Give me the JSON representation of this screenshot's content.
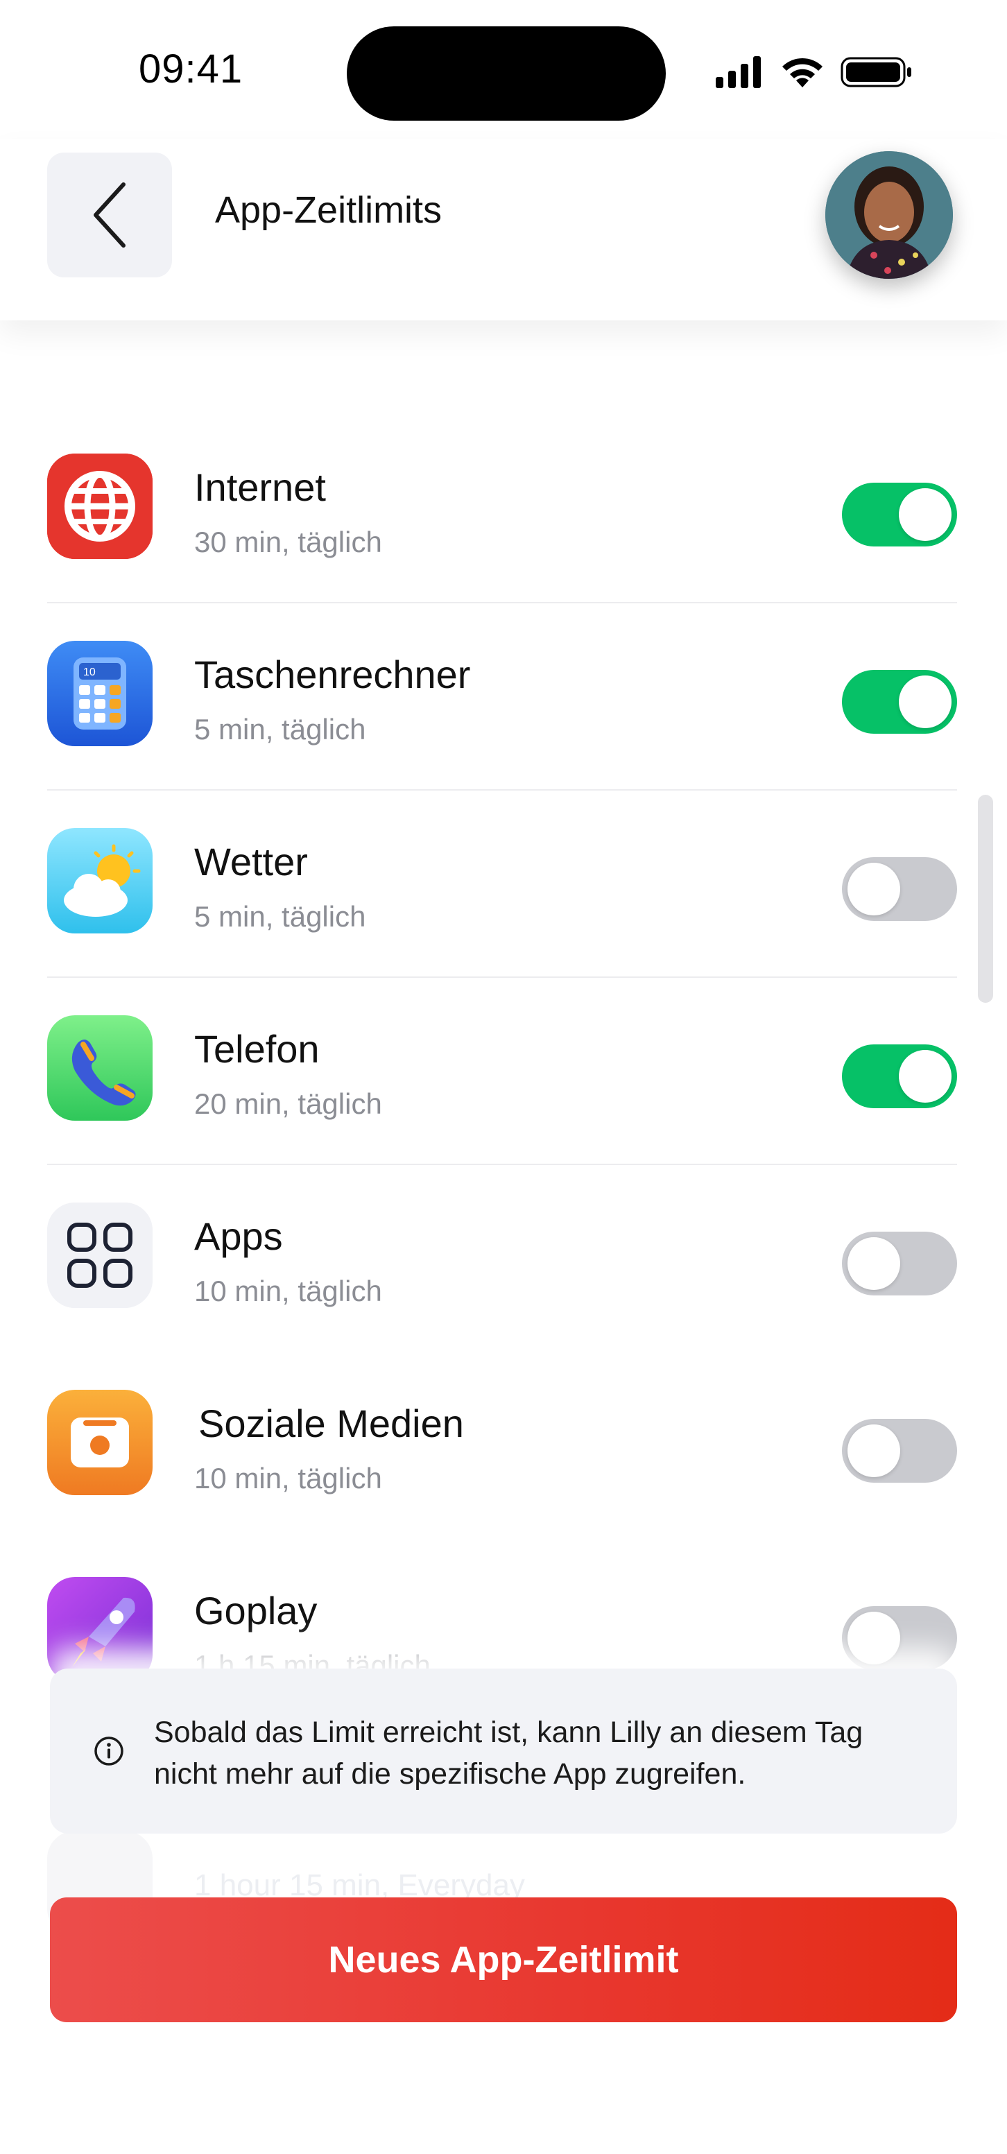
{
  "status_bar": {
    "time": "09:41"
  },
  "header": {
    "title": "App-Zeitlimits"
  },
  "apps": [
    {
      "name": "Internet",
      "limit": "30 min, täglich",
      "enabled": true,
      "icon": "globe-icon",
      "color": "#e8382f"
    },
    {
      "name": "Taschenrechner",
      "limit": "5 min, täglich",
      "enabled": true,
      "icon": "calculator-icon",
      "color": "#2f6fe8"
    },
    {
      "name": "Wetter",
      "limit": "5 min, täglich",
      "enabled": false,
      "icon": "weather-icon",
      "color": "#4fd3f3"
    },
    {
      "name": "Telefon",
      "limit": "20 min, täglich",
      "enabled": true,
      "icon": "phone-icon",
      "color": "#55d870"
    },
    {
      "name": "Apps",
      "limit": "10 min, täglich",
      "enabled": false,
      "icon": "apps-grid-icon",
      "color": "#f1f2f6"
    },
    {
      "name": "Soziale Medien",
      "limit": "10 min, täglich",
      "enabled": false,
      "icon": "camera-icon",
      "color": "#f39a2c"
    },
    {
      "name": "Goplay",
      "limit": "1 h 15 min, täglich",
      "enabled": false,
      "icon": "rocket-icon",
      "color": "#a646e6"
    }
  ],
  "info": {
    "text": "Sobald das Limit erreicht ist, kann Lilly an diesem Tag nicht mehr auf die spezifische App zugreifen."
  },
  "ghost_text": "1 hour 15 min, Everyday",
  "cta": {
    "label": "Neues App-Zeitlimit"
  },
  "colors": {
    "accent_green": "#06c167",
    "toggle_off": "#c9cacf",
    "cta_red": "#e8372e"
  }
}
